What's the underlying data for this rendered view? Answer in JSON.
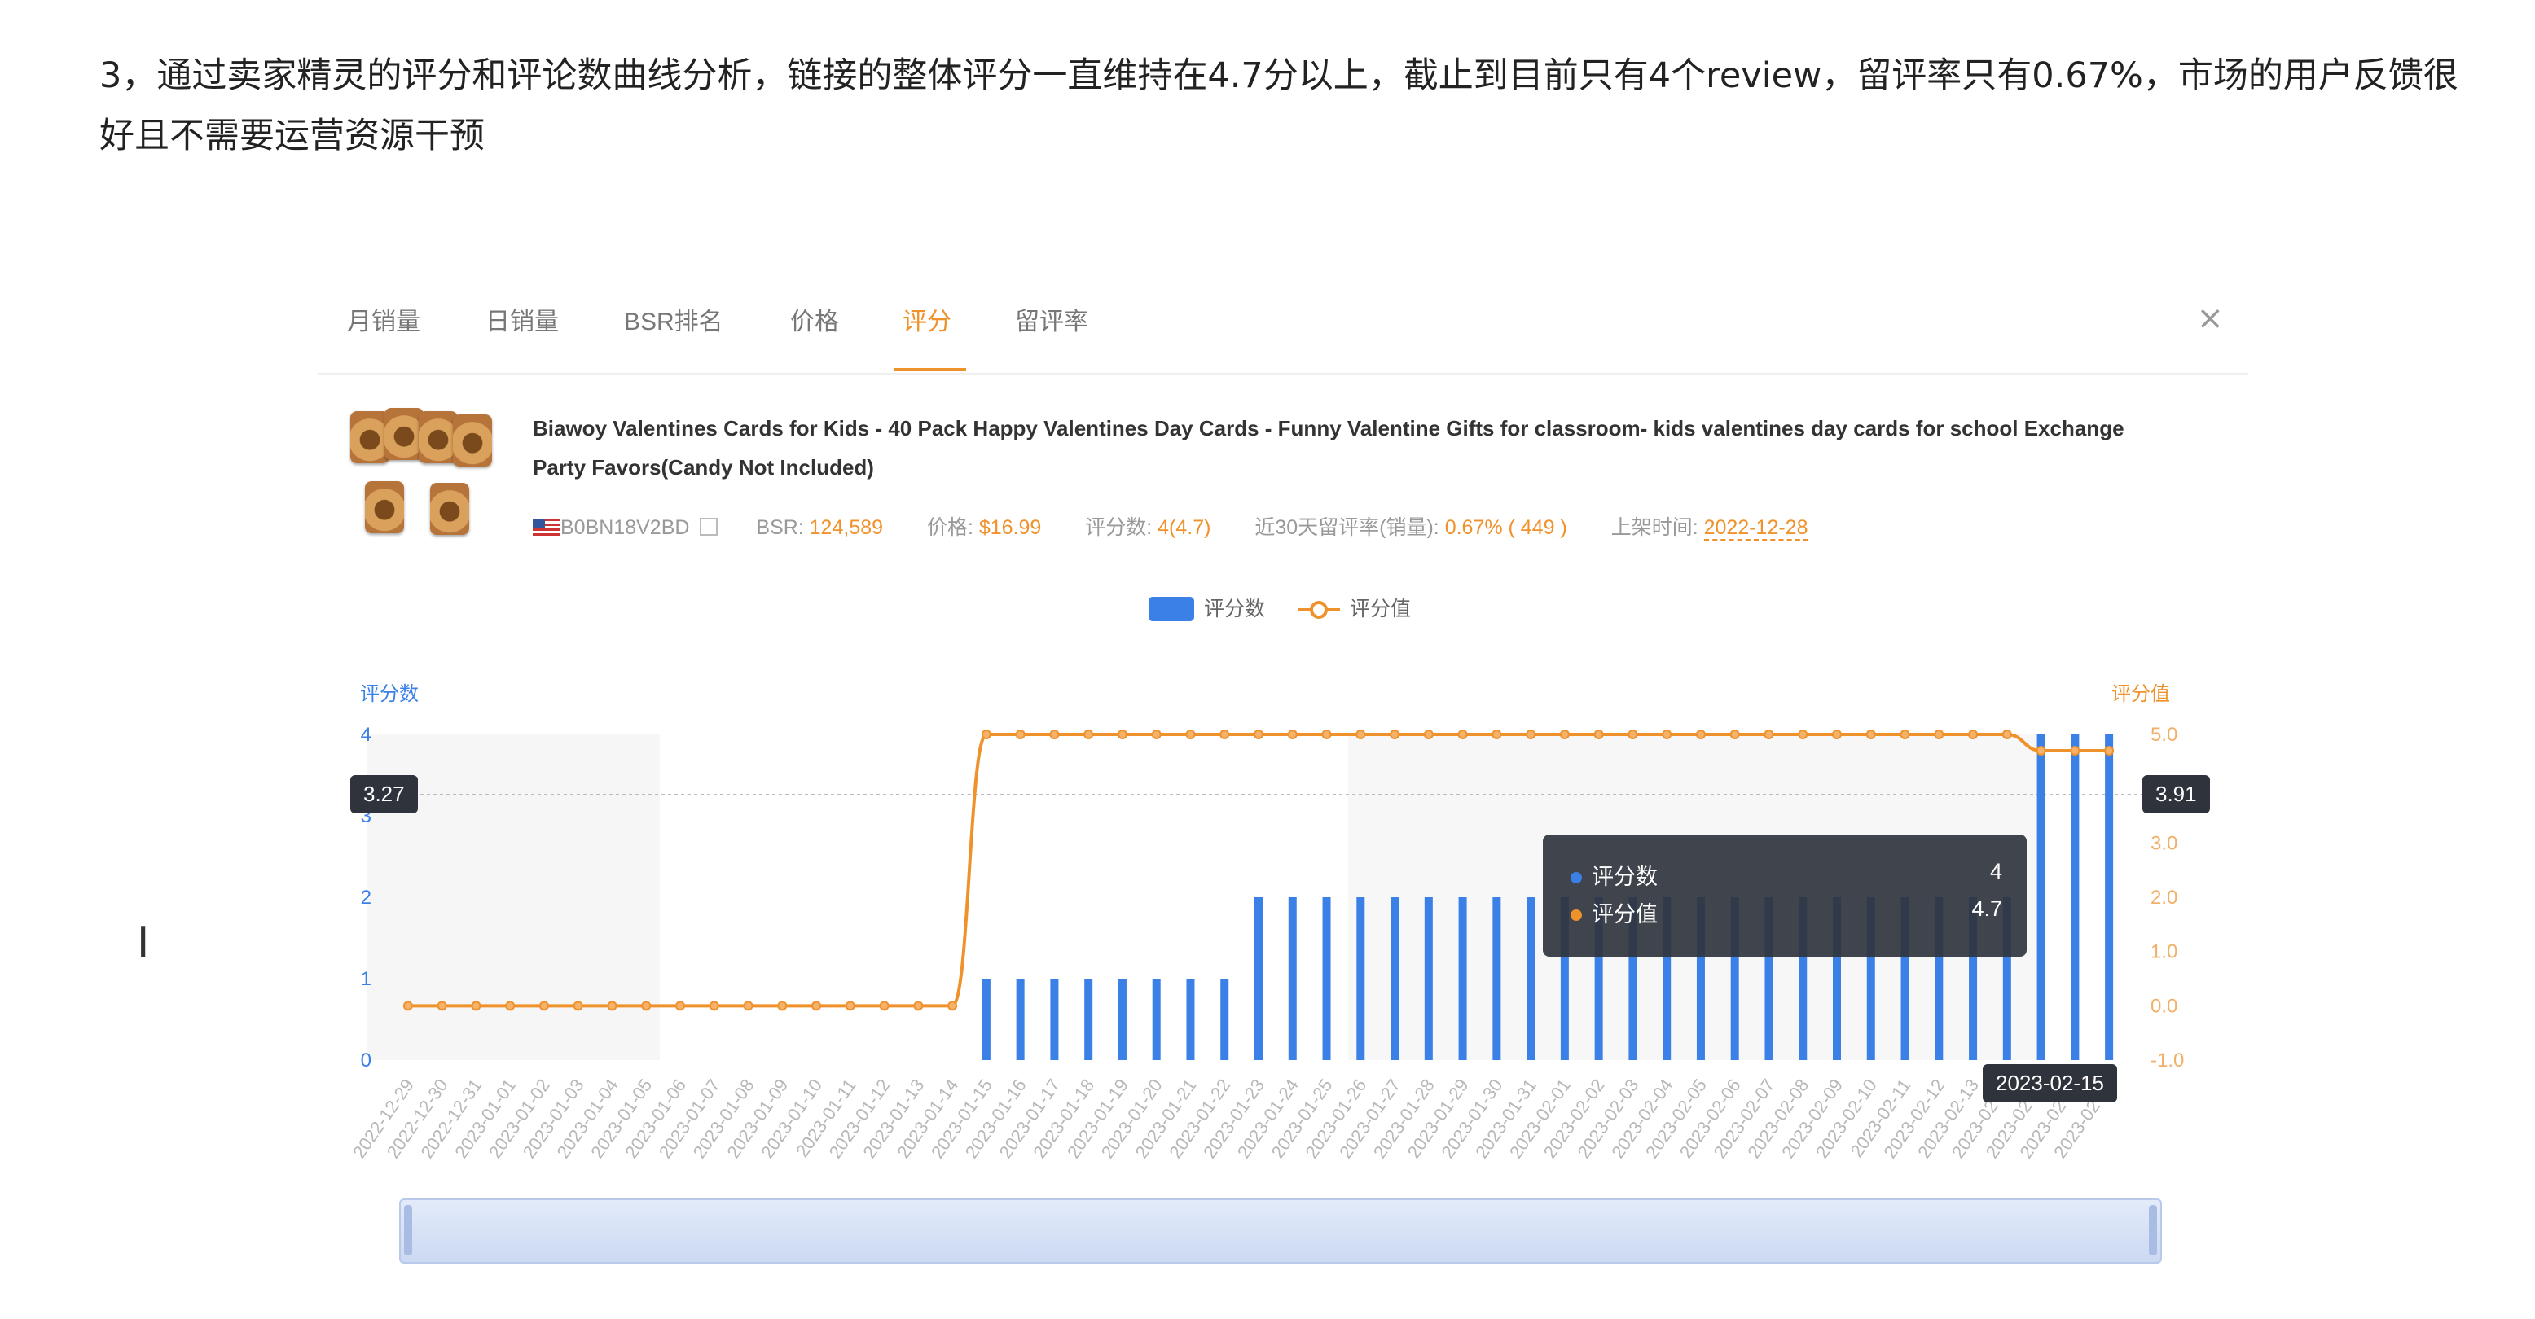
{
  "article": {
    "paragraph": "3，通过卖家精灵的评分和评论数曲线分析，链接的整体评分一直维持在4.7分以上，截止到目前只有4个review，留评率只有0.67%，市场的用户反馈很好且不需要运营资源干预"
  },
  "tabs": [
    {
      "label": "月销量"
    },
    {
      "label": "日销量"
    },
    {
      "label": "BSR排名"
    },
    {
      "label": "价格"
    },
    {
      "label": "评分",
      "active": true
    },
    {
      "label": "留评率"
    }
  ],
  "close_symbol": "×",
  "cursor_symbol": "I",
  "product": {
    "title": "Biawoy Valentines Cards for Kids - 40 Pack Happy Valentines Day Cards - Funny Valentine Gifts for classroom- kids valentines day cards for school Exchange Party Favors(Candy Not Included)",
    "asin": "B0BN18V2BD",
    "bsr_label": "BSR:",
    "bsr_value": "124,589",
    "price_label": "价格:",
    "price_value": "$16.99",
    "rating_label": "评分数:",
    "rating_value": "4(4.7)",
    "review_rate_label": "近30天留评率(销量):",
    "review_rate_value": "0.67% ( 449 )",
    "listed_label": "上架时间:",
    "listed_value": "2022-12-28"
  },
  "legend": {
    "count_label": "评分数",
    "score_label": "评分值"
  },
  "tooltip": {
    "count_label": "评分数",
    "count_value": "4",
    "score_label": "评分值",
    "score_value": "4.7"
  },
  "crosshair": {
    "left_value": "3.27",
    "right_value": "3.91",
    "date": "2023-02-15"
  },
  "colors": {
    "bar": "#3a80e6",
    "line": "#f0922c",
    "active_tab": "#f0922c"
  },
  "chart_data": {
    "type": "bar",
    "left_axis_title": "评分数",
    "right_axis_title": "评分值",
    "left_ticks": [
      "4",
      "3",
      "2",
      "1",
      "0"
    ],
    "right_ticks": [
      "5.0",
      "4.0",
      "3.0",
      "2.0",
      "1.0",
      "0.0",
      "-1.0"
    ],
    "ylim_left": [
      0,
      4
    ],
    "ylim_right": [
      -1,
      5
    ],
    "x": [
      "2022-12-29",
      "2022-12-30",
      "2022-12-31",
      "2023-01-01",
      "2023-01-02",
      "2023-01-03",
      "2023-01-04",
      "2023-01-05",
      "2023-01-06",
      "2023-01-07",
      "2023-01-08",
      "2023-01-09",
      "2023-01-10",
      "2023-01-11",
      "2023-01-12",
      "2023-01-13",
      "2023-01-14",
      "2023-01-15",
      "2023-01-16",
      "2023-01-17",
      "2023-01-18",
      "2023-01-19",
      "2023-01-20",
      "2023-01-21",
      "2023-01-22",
      "2023-01-23",
      "2023-01-24",
      "2023-01-25",
      "2023-01-26",
      "2023-01-27",
      "2023-01-28",
      "2023-01-29",
      "2023-01-30",
      "2023-01-31",
      "2023-02-01",
      "2023-02-02",
      "2023-02-03",
      "2023-02-04",
      "2023-02-05",
      "2023-02-06",
      "2023-02-07",
      "2023-02-08",
      "2023-02-09",
      "2023-02-10",
      "2023-02-11",
      "2023-02-12",
      "2023-02-13",
      "2023-02-14",
      "2023-02-15",
      "2023-02-16",
      "2023-02-17"
    ],
    "series": [
      {
        "name": "评分数",
        "type": "bar",
        "values": [
          0,
          0,
          0,
          0,
          0,
          0,
          0,
          0,
          0,
          0,
          0,
          0,
          0,
          0,
          0,
          0,
          0,
          1,
          1,
          1,
          1,
          1,
          1,
          1,
          1,
          2,
          2,
          2,
          2,
          2,
          2,
          2,
          2,
          2,
          2,
          2,
          2,
          2,
          2,
          2,
          2,
          2,
          2,
          2,
          2,
          2,
          2,
          2,
          4,
          4,
          4
        ]
      },
      {
        "name": "评分值",
        "type": "line",
        "values": [
          0,
          0,
          0,
          0,
          0,
          0,
          0,
          0,
          0,
          0,
          0,
          0,
          0,
          0,
          0,
          0,
          0,
          5,
          5,
          5,
          5,
          5,
          5,
          5,
          5,
          5,
          5,
          5,
          5,
          5,
          5,
          5,
          5,
          5,
          5,
          5,
          5,
          5,
          5,
          5,
          5,
          5,
          5,
          5,
          5,
          5,
          5,
          5,
          4.7,
          4.7,
          4.7
        ]
      }
    ],
    "grid": false,
    "legend_position": "top-center"
  }
}
